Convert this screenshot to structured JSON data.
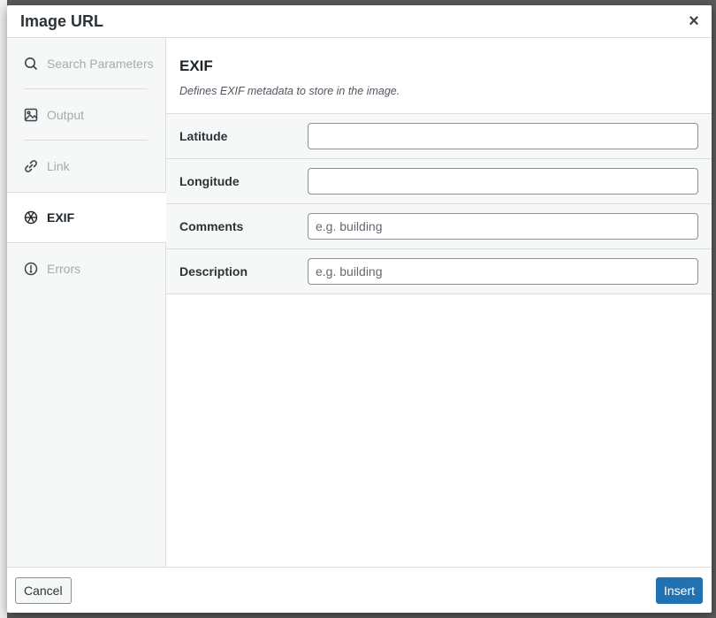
{
  "dialog": {
    "title": "Image URL",
    "close_symbol": "×"
  },
  "sidebar": {
    "items": [
      {
        "label": "Search Parameters",
        "icon": "search-icon",
        "active": false
      },
      {
        "label": "Output",
        "icon": "image-icon",
        "active": false
      },
      {
        "label": "Link",
        "icon": "link-icon",
        "active": false
      },
      {
        "label": "EXIF",
        "icon": "aperture-icon",
        "active": true
      },
      {
        "label": "Errors",
        "icon": "alert-circle-icon",
        "active": false
      }
    ]
  },
  "section": {
    "title": "EXIF",
    "description": "Defines EXIF metadata to store in the image."
  },
  "fields": [
    {
      "label": "Latitude",
      "value": "",
      "placeholder": ""
    },
    {
      "label": "Longitude",
      "value": "",
      "placeholder": ""
    },
    {
      "label": "Comments",
      "value": "",
      "placeholder": "e.g. building"
    },
    {
      "label": "Description",
      "value": "",
      "placeholder": "e.g. building"
    }
  ],
  "footer": {
    "cancel_label": "Cancel",
    "insert_label": "Insert"
  },
  "colors": {
    "primary": "#2271b1",
    "sidebar_bg": "#f6f7f7",
    "border": "#dcdcde"
  }
}
